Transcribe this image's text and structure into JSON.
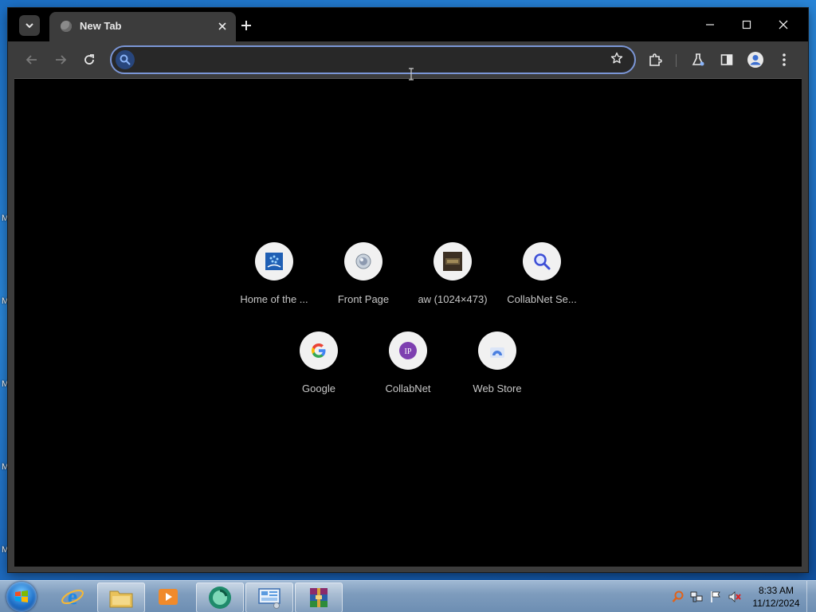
{
  "desktop": {
    "labels": [
      "M",
      "M",
      "M",
      "M",
      "M"
    ]
  },
  "browser": {
    "tab": {
      "title": "New Tab",
      "favicon": "globe-icon"
    },
    "toolbar": {
      "back": "arrow-left-icon",
      "forward": "arrow-right-icon",
      "reload": "reload-icon",
      "omnibox_value": "",
      "bookmark": "star-icon",
      "extensions": "puzzle-icon",
      "labs": "flask-icon",
      "side_panel": "side-panel-icon",
      "profile": "profile-icon",
      "menu": "kebab-menu-icon"
    },
    "accent_color": "#7b96d6",
    "shortcuts": [
      {
        "label": "Home of the ...",
        "icon": "home-of-the-site-icon"
      },
      {
        "label": "Front Page",
        "icon": "front-page-icon"
      },
      {
        "label": "aw (1024×473)",
        "icon": "aw-image-icon"
      },
      {
        "label": "CollabNet Se...",
        "icon": "collabnet-search-icon"
      },
      {
        "label": "Google",
        "icon": "google-icon"
      },
      {
        "label": "CollabNet",
        "icon": "collabnet-icon"
      },
      {
        "label": "Web Store",
        "icon": "web-store-icon"
      }
    ]
  },
  "taskbar": {
    "apps": [
      "internet-explorer-icon",
      "file-explorer-icon",
      "media-player-icon",
      "chrome-app-icon",
      "control-panel-icon",
      "winrar-icon"
    ],
    "clock": {
      "time": "8:33 AM",
      "date": "11/12/2024"
    }
  }
}
